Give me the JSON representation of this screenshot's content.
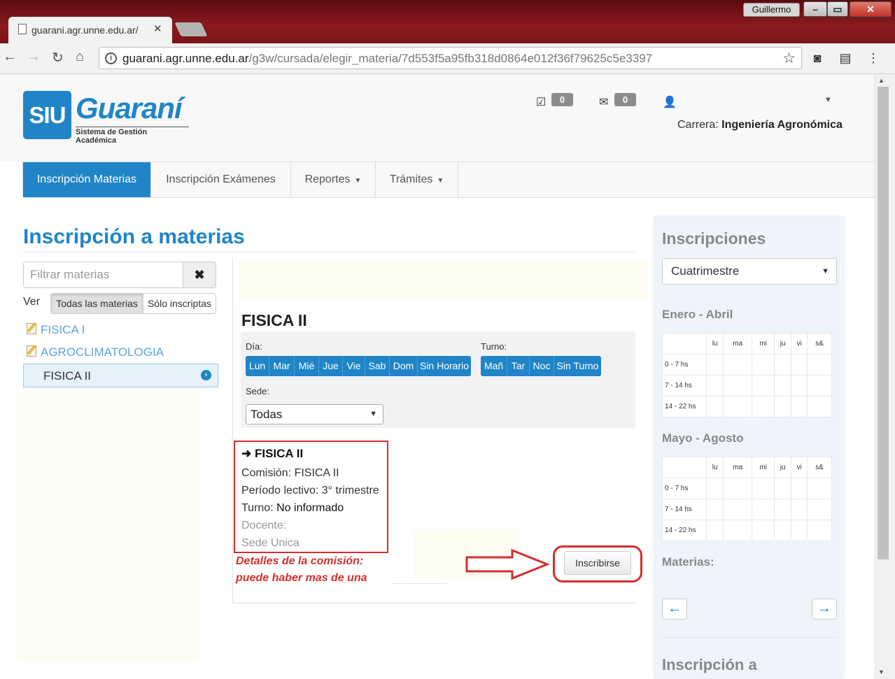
{
  "browser": {
    "tab_title": "guarani.agr.unne.edu.ar/",
    "url_host": "guarani.agr.unne.edu.ar",
    "url_path": "/g3w/cursada/elegir_materia/7d553f5a95fb318d0864e012f36f79625c5e3397",
    "window_user": "Guillermo"
  },
  "header": {
    "logo_siu": "SIU",
    "logo_name": "Guaraní",
    "logo_subtitle": "Sistema de Gestión Académica",
    "tasks_count": "0",
    "messages_count": "0",
    "carrera_label": "Carrera:",
    "carrera_value": "Ingeniería Agronómica"
  },
  "nav": {
    "items": [
      "Inscripción Materias",
      "Inscripción Exámenes",
      "Reportes",
      "Trámites"
    ]
  },
  "main": {
    "page_title": "Inscripción a materias",
    "filter_placeholder": "Filtrar materias",
    "ver_label": "Ver",
    "view_options": [
      "Todas las materias",
      "Sólo inscriptas"
    ],
    "materias": [
      "FISICA I",
      "AGROCLIMATOLOGIA",
      "FISICA II"
    ],
    "subject_title": "FISICA II",
    "dia_label": "Día:",
    "days": [
      "Lun",
      "Mar",
      "Mié",
      "Jue",
      "Vie",
      "Sab",
      "Dom",
      "Sin Horario"
    ],
    "turno_label": "Turno:",
    "turnos": [
      "Mañ",
      "Tar",
      "Noc",
      "Sin Turno"
    ],
    "sede_label": "Sede:",
    "sede_value": "Todas",
    "comision": {
      "title": "FISICA II",
      "comision": "Comisión: FISICA II",
      "periodo": "Período lectivo: 3° trimestre",
      "turno_label": "Turno:",
      "turno_value": "No informado",
      "docente": "Docente:",
      "sede": "Sede Unica"
    },
    "annotation_line1": "Detalles de la comisión:",
    "annotation_line2": "puede haber mas de una",
    "inscribirse_label": "Inscribirse"
  },
  "sidebar_right": {
    "title": "Inscripciones",
    "period_select": "Cuatrimestre",
    "block1_title": "Enero - Abril",
    "block2_title": "Mayo - Agosto",
    "days": [
      "lu",
      "ma",
      "mi",
      "ju",
      "vi",
      "s&"
    ],
    "rows": [
      "0 - 7 hs",
      "7 - 14 hs",
      "14 - 22 hs"
    ],
    "materias_label": "Materias:",
    "prev": "←",
    "next": "→",
    "footer_title": "Inscripción a"
  }
}
